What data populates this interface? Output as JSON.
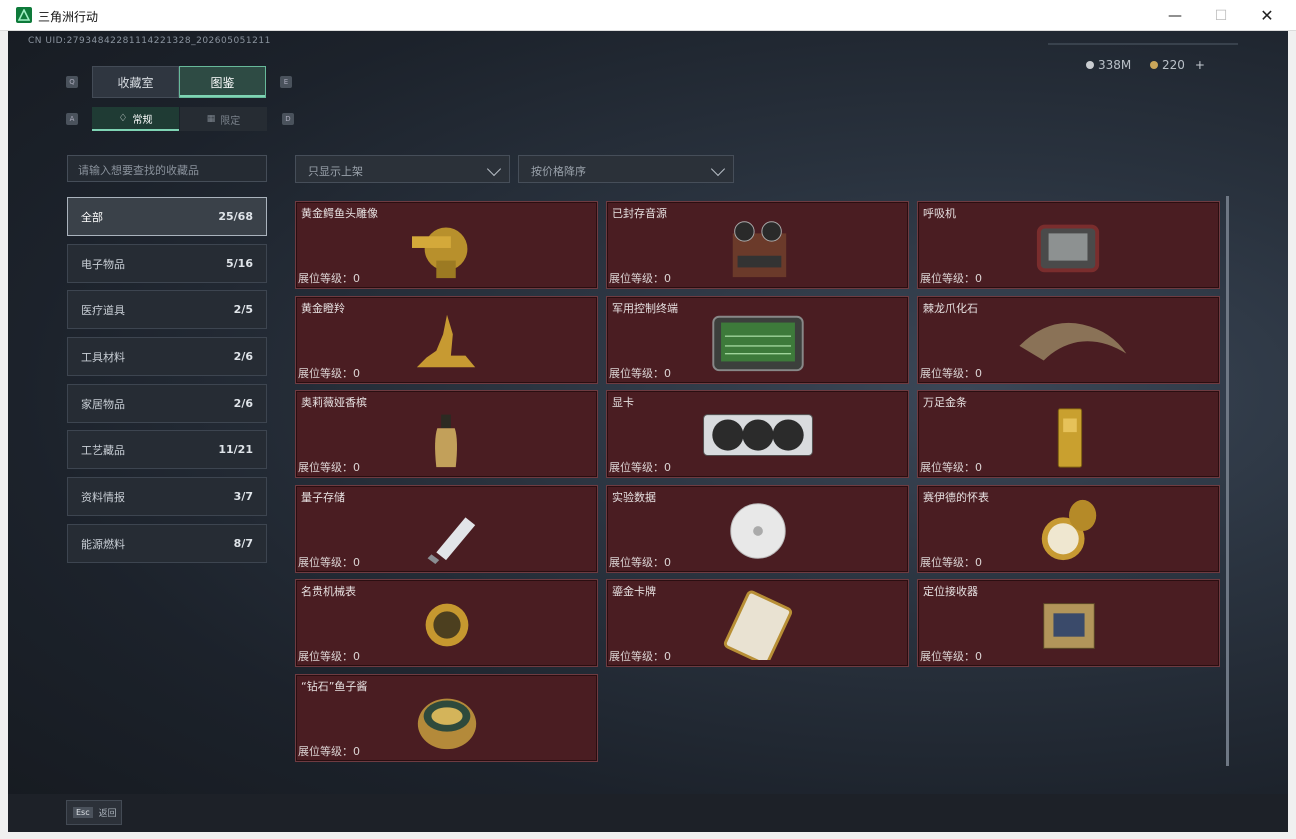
{
  "window": {
    "title": "三角洲行动"
  },
  "header": {
    "uid": "CN UID:27934842281114221328_202605051211",
    "currency": [
      {
        "value": "338M",
        "color": "#c9ccd0"
      },
      {
        "value": "220",
        "color": "#c9a65a"
      }
    ],
    "plus_label": "+"
  },
  "keys": {
    "left_top": "Q",
    "right_top": "E",
    "left_sub": "A",
    "right_sub": "D"
  },
  "tabs": [
    {
      "label": "收藏室",
      "active": false
    },
    {
      "label": "图鉴",
      "active": true
    }
  ],
  "subtabs": [
    {
      "label": "常规",
      "icon": "crystal-icon",
      "active": true
    },
    {
      "label": "限定",
      "icon": "limited-icon",
      "active": false
    }
  ],
  "search": {
    "placeholder": "请输入想要查找的收藏品"
  },
  "filters": [
    {
      "label": "只显示上架"
    },
    {
      "label": "按价格降序"
    }
  ],
  "categories": [
    {
      "label": "全部",
      "count": "25/68",
      "active": true
    },
    {
      "label": "电子物品",
      "count": "5/16"
    },
    {
      "label": "医疗道具",
      "count": "2/5"
    },
    {
      "label": "工具材料",
      "count": "2/6"
    },
    {
      "label": "家居物品",
      "count": "2/6"
    },
    {
      "label": "工艺藏品",
      "count": "11/21"
    },
    {
      "label": "资料情报",
      "count": "3/7"
    },
    {
      "label": "能源燃料",
      "count": "8/7"
    }
  ],
  "level_label": "展位等级：0",
  "items": [
    {
      "name": "黄金鳄鱼头雕像",
      "icon": "croc-head-statue-icon"
    },
    {
      "name": "已封存音源",
      "icon": "reel-recorder-icon"
    },
    {
      "name": "呼吸机",
      "icon": "ventilator-icon"
    },
    {
      "name": "黄金瞪羚",
      "icon": "golden-gazelle-icon"
    },
    {
      "name": "军用控制终端",
      "icon": "control-terminal-icon"
    },
    {
      "name": "棘龙爪化石",
      "icon": "claw-fossil-icon"
    },
    {
      "name": "奥莉薇娅香槟",
      "icon": "champagne-icon"
    },
    {
      "name": "显卡",
      "icon": "gpu-icon"
    },
    {
      "name": "万足金条",
      "icon": "gold-bar-icon"
    },
    {
      "name": "量子存储",
      "icon": "usb-drive-icon"
    },
    {
      "name": "实验数据",
      "icon": "disc-icon"
    },
    {
      "name": "赛伊德的怀表",
      "icon": "pocket-watch-icon"
    },
    {
      "name": "名贵机械表",
      "icon": "wristwatch-icon"
    },
    {
      "name": "鎏金卡牌",
      "icon": "gilded-card-icon"
    },
    {
      "name": "定位接收器",
      "icon": "receiver-icon"
    },
    {
      "name": "“钻石”鱼子酱",
      "icon": "caviar-tin-icon"
    }
  ],
  "footer": {
    "esc_key": "Esc",
    "back_label": "返回"
  }
}
